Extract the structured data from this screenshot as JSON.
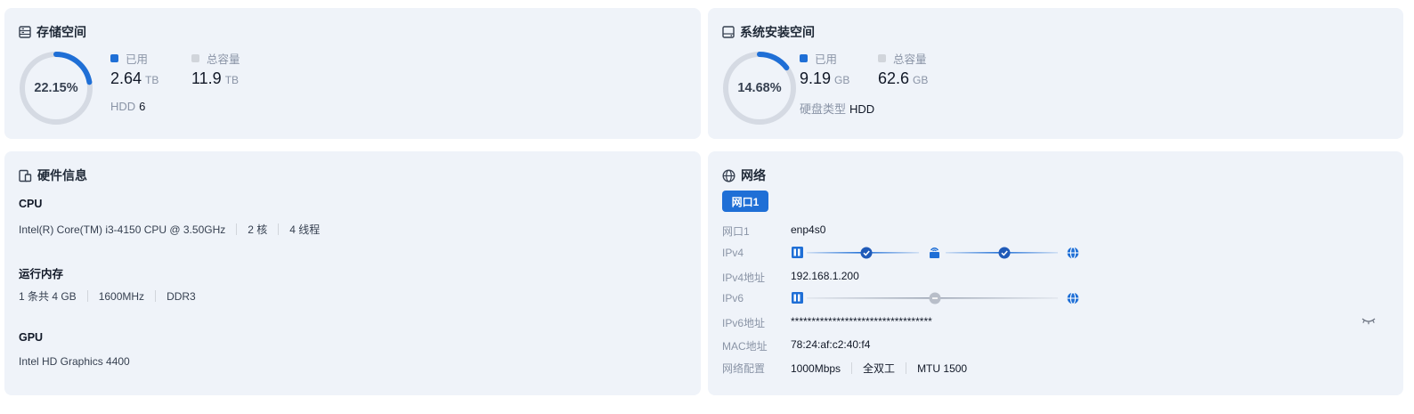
{
  "storage": {
    "title": "存储空间",
    "percent": 22.15,
    "percent_text": "22.15%",
    "used_label": "已用",
    "used_value": "2.64",
    "used_unit": "TB",
    "total_label": "总容量",
    "total_value": "11.9",
    "total_unit": "TB",
    "disk_label": "HDD",
    "disk_count": "6"
  },
  "system": {
    "title": "系统安装空间",
    "percent": 14.68,
    "percent_text": "14.68%",
    "used_label": "已用",
    "used_value": "9.19",
    "used_unit": "GB",
    "total_label": "总容量",
    "total_value": "62.6",
    "total_unit": "GB",
    "disk_type_label": "硬盘类型",
    "disk_type_value": "HDD"
  },
  "hardware": {
    "title": "硬件信息",
    "cpu_heading": "CPU",
    "cpu_model": "Intel(R) Core(TM) i3-4150 CPU @ 3.50GHz",
    "cpu_cores": "2 核",
    "cpu_threads": "4 线程",
    "memory_heading": "运行内存",
    "memory_size": "1 条共 4 GB",
    "memory_speed": "1600MHz",
    "memory_type": "DDR3",
    "gpu_heading": "GPU",
    "gpu_model": "Intel HD Graphics 4400"
  },
  "network": {
    "title": "网络",
    "tab_label": "网口1",
    "iface_label": "网口1",
    "iface_value": "enp4s0",
    "ipv4_label": "IPv4",
    "ipv4_addr_label": "IPv4地址",
    "ipv4_addr_value": "192.168.1.200",
    "ipv6_label": "IPv6",
    "ipv6_addr_label": "IPv6地址",
    "ipv6_addr_value": "**********************************",
    "mac_label": "MAC地址",
    "mac_value": "78:24:af:c2:40:f4",
    "config_label": "网络配置",
    "config_speed": "1000Mbps",
    "config_duplex": "全双工",
    "config_mtu": "MTU 1500"
  },
  "colors": {
    "accent": "#1f6fd6",
    "ring_track": "#d5dae3",
    "total_swatch": "#d1d5db",
    "card_bg": "#eff3f9",
    "ipv6_inactive": "#b8bec9"
  },
  "icons": {
    "storage": "storage-icon",
    "system": "hard-drive-icon",
    "hardware": "devices-icon",
    "network": "globe-icon",
    "eye_toggle": "eye-closed-icon"
  }
}
